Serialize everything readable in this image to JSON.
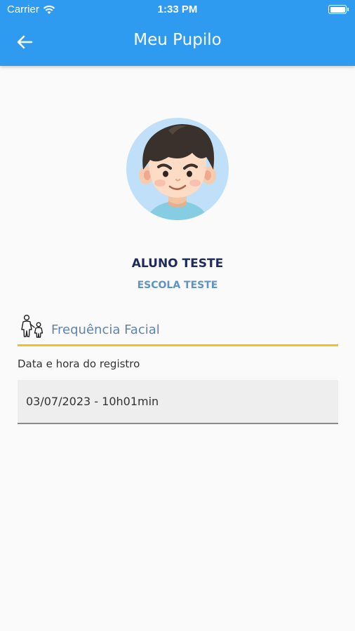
{
  "status_bar": {
    "carrier": "Carrier",
    "time": "1:33 PM"
  },
  "header": {
    "title": "Meu Pupilo",
    "back_icon": "arrow-left-icon",
    "background_color": "#2f9bf0"
  },
  "profile": {
    "avatar_icon": "boy-avatar",
    "name": "ALUNO TESTE",
    "school": "ESCOLA TESTE"
  },
  "section": {
    "icon": "parent-child-icon",
    "title": "Frequência Facial",
    "accent_color": "#f2c11b"
  },
  "record": {
    "label": "Data e hora do registro",
    "value": "03/07/2023 - 10h01min"
  }
}
